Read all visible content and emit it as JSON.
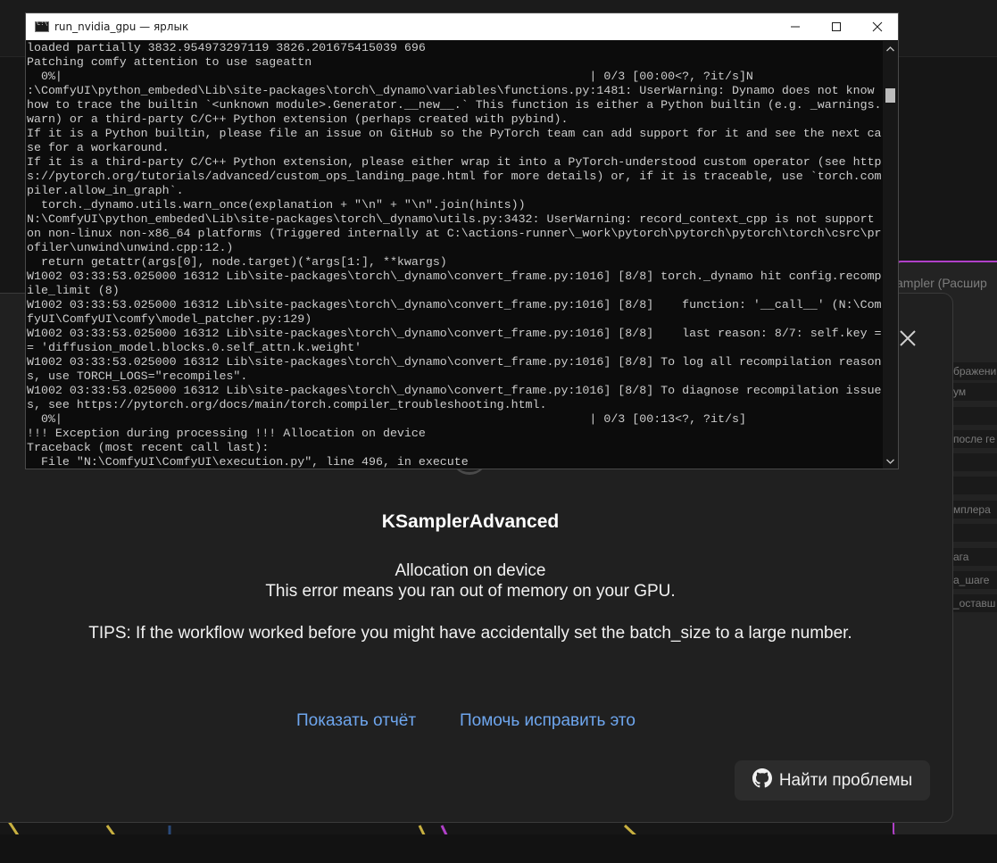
{
  "window": {
    "title": "run_nvidia_gpu — ярлык",
    "controls": [
      "minimize",
      "maximize",
      "close"
    ]
  },
  "console": {
    "lines": [
      "loaded partially 3832.954973297119 3826.201675415039 696",
      "Patching comfy attention to use sageattn",
      "  0%|                                                                          | 0/3 [00:00<?, ?it/s]N",
      ":\\ComfyUI\\python_embeded\\Lib\\site-packages\\torch\\_dynamo\\variables\\functions.py:1481: UserWarning: Dynamo does not know",
      "how to trace the builtin `<unknown module>.Generator.__new__.` This function is either a Python builtin (e.g. _warnings.",
      "warn) or a third-party C/C++ Python extension (perhaps created with pybind).",
      "If it is a Python builtin, please file an issue on GitHub so the PyTorch team can add support for it and see the next ca",
      "se for a workaround.",
      "If it is a third-party C/C++ Python extension, please either wrap it into a PyTorch-understood custom operator (see http",
      "s://pytorch.org/tutorials/advanced/custom_ops_landing_page.html for more details) or, if it is traceable, use `torch.com",
      "piler.allow_in_graph`.",
      "  torch._dynamo.utils.warn_once(explanation + \"\\n\" + \"\\n\".join(hints))",
      "N:\\ComfyUI\\python_embeded\\Lib\\site-packages\\torch\\_dynamo\\utils.py:3432: UserWarning: record_context_cpp is not support",
      "on non-linux non-x86_64 platforms (Triggered internally at C:\\actions-runner\\_work\\pytorch\\pytorch\\pytorch\\torch\\csrc\\pr",
      "ofiler\\unwind\\unwind.cpp:12.)",
      "  return getattr(args[0], node.target)(*args[1:], **kwargs)",
      "W1002 03:33:53.025000 16312 Lib\\site-packages\\torch\\_dynamo\\convert_frame.py:1016] [8/8] torch._dynamo hit config.recomp",
      "ile_limit (8)",
      "W1002 03:33:53.025000 16312 Lib\\site-packages\\torch\\_dynamo\\convert_frame.py:1016] [8/8]    function: '__call__' (N:\\Com",
      "fyUI\\ComfyUI\\comfy\\model_patcher.py:129)",
      "W1002 03:33:53.025000 16312 Lib\\site-packages\\torch\\_dynamo\\convert_frame.py:1016] [8/8]    last reason: 8/7: self.key =",
      "= 'diffusion_model.blocks.0.self_attn.k.weight'",
      "W1002 03:33:53.025000 16312 Lib\\site-packages\\torch\\_dynamo\\convert_frame.py:1016] [8/8] To log all recompilation reason",
      "s, use TORCH_LOGS=\"recompiles\".",
      "W1002 03:33:53.025000 16312 Lib\\site-packages\\torch\\_dynamo\\convert_frame.py:1016] [8/8] To diagnose recompilation issue",
      "s, see https://pytorch.org/docs/main/torch.compiler_troubleshooting.html.",
      "  0%|                                                                          | 0/3 [00:13<?, ?it/s]",
      "!!! Exception during processing !!! Allocation on device",
      "Traceback (most recent call last):",
      "  File \"N:\\ComfyUI\\ComfyUI\\execution.py\", line 496, in execute"
    ]
  },
  "dialog": {
    "node_name": "KSamplerAdvanced",
    "error": "Allocation on device",
    "explanation": "This error means you ran out of memory on your GPU.",
    "tips": "TIPS: If the workflow worked before you might have accidentally set the batch_size to a large number.",
    "show_report_label": "Показать отчёт",
    "help_fix_label": "Помочь исправить это",
    "find_issues_label": "Найти проблемы",
    "find_issues_icon": "github-icon",
    "close_icon": "close-icon"
  },
  "background": {
    "node_title": "ampler (Расшир",
    "fields": [
      "бражени",
      "ум",
      "после ге",
      "мплера",
      "ага",
      "а_шаге",
      "_оставш"
    ],
    "accent_color": "#b040c8"
  }
}
